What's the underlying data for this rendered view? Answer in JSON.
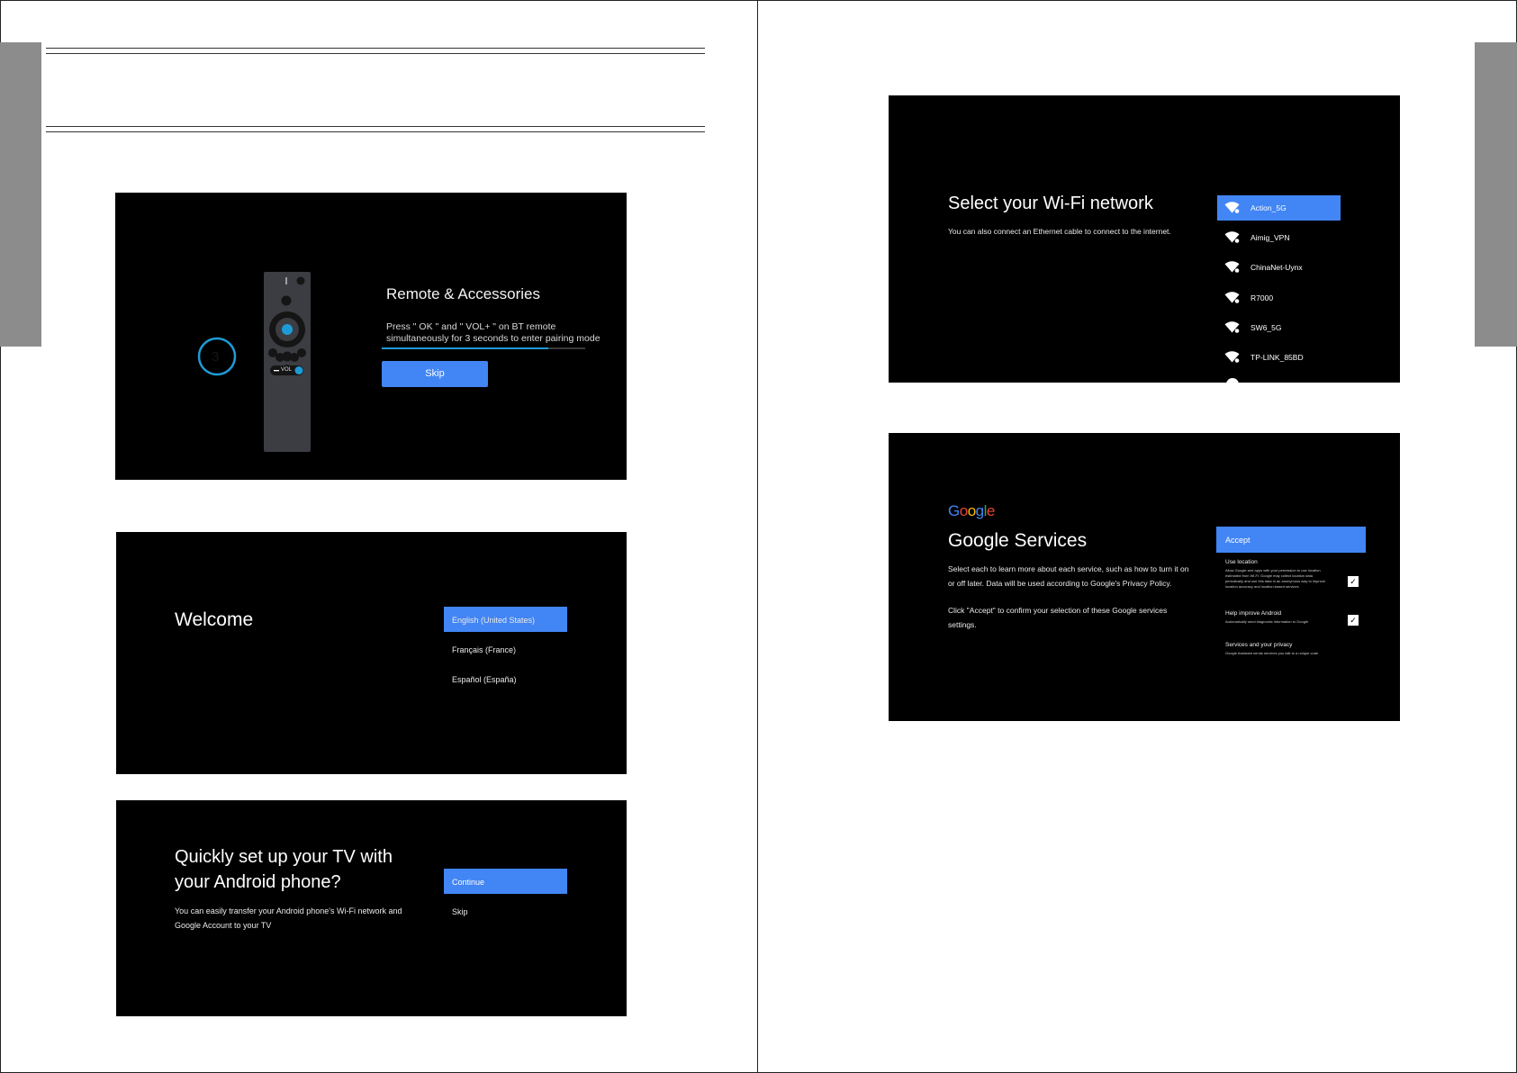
{
  "remote_screen": {
    "title": "Remote & Accessories",
    "instruction_line1": "Press \" OK \" and \" VOL+ \" on BT remote",
    "instruction_line2": "simultaneously for 3 seconds to enter pairing mode",
    "countdown": "3",
    "vol_label": "VOL",
    "skip_label": "Skip",
    "progress": 0.82
  },
  "welcome_screen": {
    "title": "Welcome",
    "languages": [
      "English (United States)",
      "Français (France)",
      "Español (España)"
    ],
    "selected_index": 0
  },
  "quick_setup_screen": {
    "title_line1": "Quickly set up your TV with",
    "title_line2": "your Android phone?",
    "desc_line1": "You can easily transfer your Android phone's Wi-Fi network and",
    "desc_line2": "Google Account to your TV",
    "continue_label": "Continue",
    "skip_label": "Skip"
  },
  "wifi_screen": {
    "title": "Select your Wi-Fi network",
    "subtitle": "You can also connect an Ethernet cable to connect to the internet.",
    "networks": [
      "Action_5G",
      "Aimig_VPN",
      "ChinaNet-Uynx",
      "R7000",
      "SW6_5G",
      "TP-LINK_85BD"
    ],
    "selected_index": 0
  },
  "google_screen": {
    "logo_text": "Google",
    "title": "Google Services",
    "desc_line1": "Select each to learn more about each service, such as how to turn it on",
    "desc_line2": "or off later. Data will be used according to Google's Privacy Policy.",
    "confirm_line1": "Click \"Accept\" to confirm your selection of these Google services",
    "confirm_line2": "settings.",
    "accept_label": "Accept",
    "options": [
      {
        "title": "Use location",
        "desc": "Allow Google and apps with your permission to use location estimated from Wi-Fi. Google may collect location data periodically and use this data in an anonymous way to improve location accuracy and location-based services",
        "checked": true
      },
      {
        "title": "Help improve Android",
        "desc": "Automatically send diagnostic information to Google",
        "checked": true
      },
      {
        "title": "Services and your privacy",
        "desc": "Google Assistant sends services you talk to a unique code",
        "checked": false
      }
    ]
  },
  "colors": {
    "accent": "#4285f4",
    "screen_bg": "#000000",
    "tab_gray": "#8c8c8c",
    "ring": "#1e9bd7"
  }
}
